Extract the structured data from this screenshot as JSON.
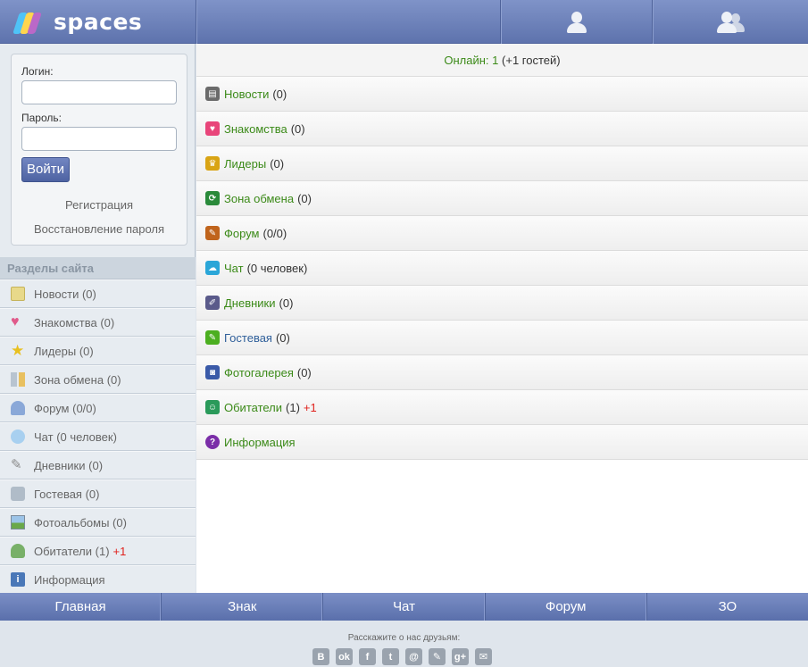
{
  "header": {
    "logo_text": "spaces",
    "icons": [
      "user-icon",
      "users-icon"
    ]
  },
  "login": {
    "login_label": "Логин:",
    "login_value": "",
    "password_label": "Пароль:",
    "password_value": "",
    "submit_label": "Войти",
    "register_link": "Регистрация",
    "recover_link": "Восстановление пароля"
  },
  "sidebar": {
    "title": "Разделы сайта",
    "items": [
      {
        "label": "Новости",
        "count": "(0)",
        "plus": "",
        "icon": "news-icon"
      },
      {
        "label": "Знакомства",
        "count": "(0)",
        "plus": "",
        "icon": "heart-icon"
      },
      {
        "label": "Лидеры",
        "count": "(0)",
        "plus": "",
        "icon": "star-icon"
      },
      {
        "label": "Зона обмена",
        "count": "(0)",
        "plus": "",
        "icon": "grid-icon"
      },
      {
        "label": "Форум",
        "count": "(0/0)",
        "plus": "",
        "icon": "forum-icon"
      },
      {
        "label": "Чат",
        "count": "(0 человек)",
        "plus": "",
        "icon": "chat-icon"
      },
      {
        "label": "Дневники",
        "count": "(0)",
        "plus": "",
        "icon": "pen-icon"
      },
      {
        "label": "Гостевая",
        "count": "(0)",
        "plus": "",
        "icon": "guestbook-icon"
      },
      {
        "label": "Фотоальбомы",
        "count": "(0)",
        "plus": "",
        "icon": "photo-icon"
      },
      {
        "label": "Обитатели",
        "count": "(1)",
        "plus": "+1",
        "icon": "user-icon"
      },
      {
        "label": "Информация",
        "count": "",
        "plus": "",
        "icon": "info-icon"
      }
    ]
  },
  "main": {
    "online_label": "Онлайн:",
    "online_count": "1",
    "online_guests": "(+1 гостей)",
    "items": [
      {
        "label": "Новости",
        "count": "(0)",
        "plus": "",
        "color": "#6b6b6b",
        "glyph": "▤",
        "icon": "news-icon"
      },
      {
        "label": "Знакомства",
        "count": "(0)",
        "plus": "",
        "color": "#e8457a",
        "glyph": "♥",
        "icon": "heart-icon"
      },
      {
        "label": "Лидеры",
        "count": "(0)",
        "plus": "",
        "color": "#d9a414",
        "glyph": "♛",
        "icon": "trophy-icon"
      },
      {
        "label": "Зона обмена",
        "count": "(0)",
        "plus": "",
        "color": "#2a8a3a",
        "glyph": "⟳",
        "icon": "exchange-icon"
      },
      {
        "label": "Форум",
        "count": "(0/0)",
        "plus": "",
        "color": "#c0641c",
        "glyph": "✎",
        "icon": "forum-icon"
      },
      {
        "label": "Чат",
        "count": "(0 человек)",
        "plus": "",
        "color": "#2aa6d8",
        "glyph": "☁",
        "icon": "chat-icon"
      },
      {
        "label": "Дневники",
        "count": "(0)",
        "plus": "",
        "color": "#5a5a8a",
        "glyph": "✐",
        "icon": "diary-icon"
      },
      {
        "label": "Гостевая",
        "count": "(0)",
        "plus": "",
        "color": "#4caf20",
        "glyph": "✎",
        "icon": "guestbook-icon"
      },
      {
        "label": "Фотогалерея",
        "count": "(0)",
        "plus": "",
        "color": "#3a5aa8",
        "glyph": "◙",
        "icon": "camera-icon"
      },
      {
        "label": "Обитатели",
        "count": "(1)",
        "plus": "+1",
        "color": "#2a9a5a",
        "glyph": "☺",
        "icon": "users-icon"
      },
      {
        "label": "Информация",
        "count": "",
        "plus": "",
        "color": "#7b2ea8",
        "glyph": "?",
        "icon": "question-icon"
      }
    ]
  },
  "bottom_nav": [
    "Главная",
    "Знак",
    "Чат",
    "Форум",
    "ЗО"
  ],
  "footer": {
    "share_text": "Расскажите о нас друзьям:",
    "social": [
      "В",
      "ok",
      "f",
      "t",
      "@",
      "✎",
      "g+",
      "✉"
    ]
  }
}
